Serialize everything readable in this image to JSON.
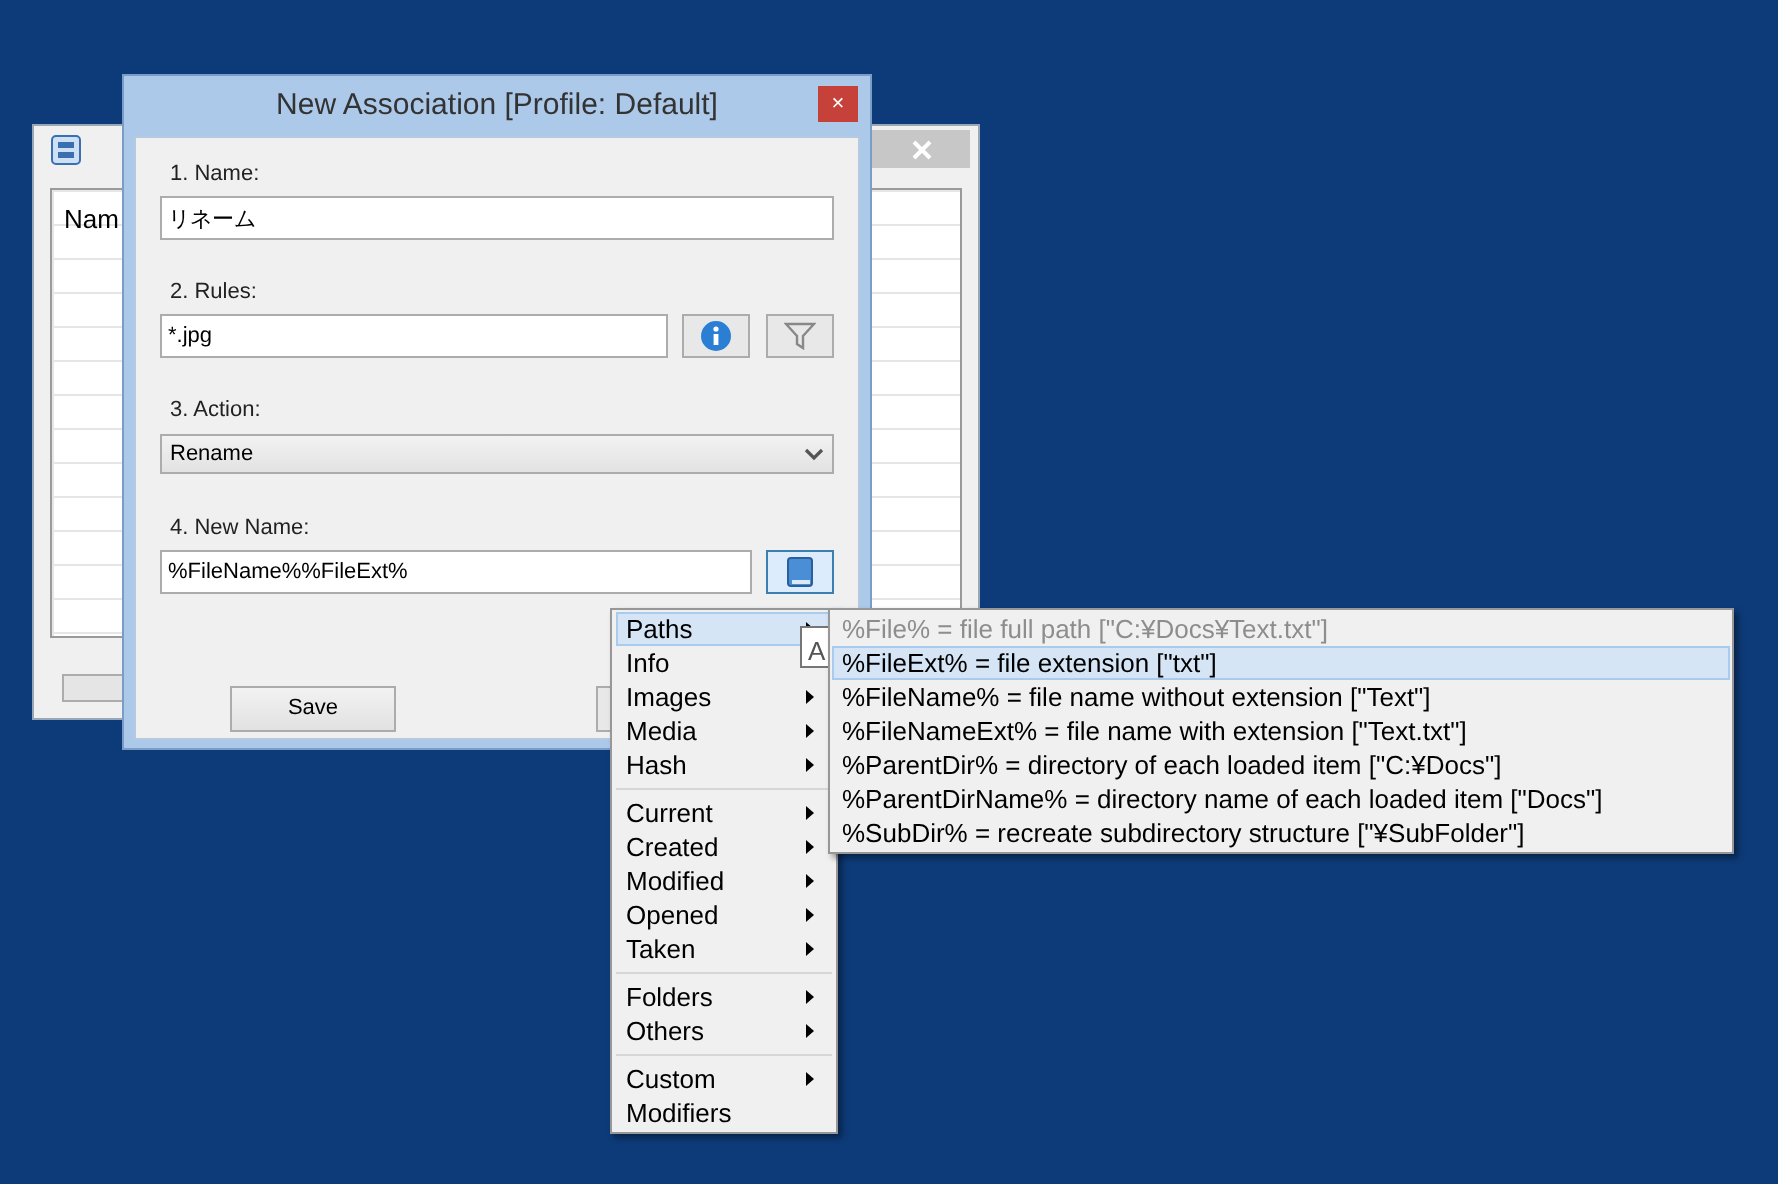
{
  "back_window": {
    "table": {
      "column_1": "Nam"
    }
  },
  "dialog": {
    "title": "New Association [Profile: Default]",
    "close": "×",
    "fields": [
      {
        "kind": "text",
        "label": "1. Name:",
        "value": "リネーム"
      },
      {
        "kind": "rules",
        "label": "2. Rules:",
        "value": "*.jpg"
      },
      {
        "kind": "select",
        "label": "3. Action:",
        "value": "Rename"
      },
      {
        "kind": "newname",
        "label": "4. New Name:",
        "value": "%FileName%%FileExt%"
      }
    ],
    "buttons": [
      "Save"
    ]
  },
  "menu": {
    "groups": [
      [
        {
          "label": "Paths",
          "submenu": true,
          "selected": true
        },
        {
          "label": "Info",
          "submenu": false,
          "selected": false
        },
        {
          "label": "Images",
          "submenu": true,
          "selected": false
        },
        {
          "label": "Media",
          "submenu": true,
          "selected": false
        },
        {
          "label": "Hash",
          "submenu": true,
          "selected": false
        }
      ],
      [
        {
          "label": "Current",
          "submenu": true,
          "selected": false
        },
        {
          "label": "Created",
          "submenu": true,
          "selected": false
        },
        {
          "label": "Modified",
          "submenu": true,
          "selected": false
        },
        {
          "label": "Opened",
          "submenu": true,
          "selected": false
        },
        {
          "label": "Taken",
          "submenu": true,
          "selected": false
        }
      ],
      [
        {
          "label": "Folders",
          "submenu": true,
          "selected": false
        },
        {
          "label": "Others",
          "submenu": true,
          "selected": false
        }
      ],
      [
        {
          "label": "Custom",
          "submenu": true,
          "selected": false
        },
        {
          "label": "Modifiers",
          "submenu": false,
          "selected": false
        }
      ]
    ]
  },
  "tooltip": "A",
  "submenu": {
    "items": [
      {
        "label": "%File% = file full path [\"C:¥Docs¥Text.txt\"]",
        "disabled": true,
        "selected": false
      },
      {
        "label": "%FileExt% = file extension [\"txt\"]",
        "disabled": false,
        "selected": true
      },
      {
        "label": "%FileName% = file name without extension [\"Text\"]",
        "disabled": false,
        "selected": false
      },
      {
        "label": "%FileNameExt% = file name with extension [\"Text.txt\"]",
        "disabled": false,
        "selected": false
      },
      {
        "label": "%ParentDir% = directory of each loaded item [\"C:¥Docs\"]",
        "disabled": false,
        "selected": false
      },
      {
        "label": "%ParentDirName% = directory name of each loaded item [\"Docs\"]",
        "disabled": false,
        "selected": false
      },
      {
        "label": "%SubDir% = recreate subdirectory structure [\"¥SubFolder\"]",
        "disabled": false,
        "selected": false
      }
    ]
  }
}
